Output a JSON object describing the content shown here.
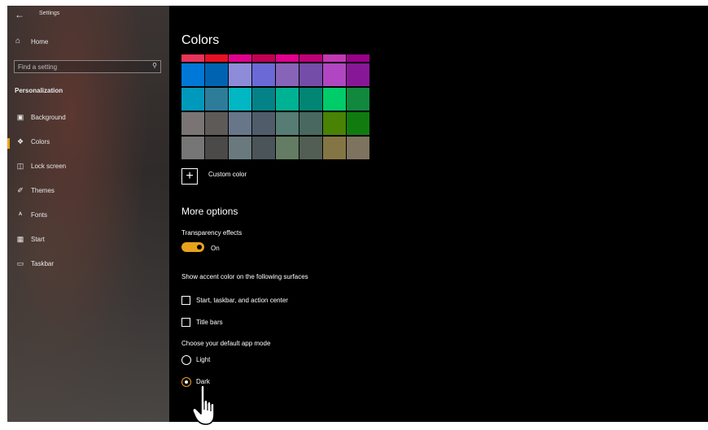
{
  "app": {
    "title": "Settings",
    "back_icon": "back-arrow-icon"
  },
  "sidebar": {
    "home": {
      "label": "Home",
      "icon": "home-icon"
    },
    "search": {
      "placeholder": "Find a setting",
      "icon": "search-icon"
    },
    "section_header": "Personalization",
    "items": [
      {
        "label": "Background",
        "icon": "picture-icon",
        "selected": false
      },
      {
        "label": "Colors",
        "icon": "palette-icon",
        "selected": true
      },
      {
        "label": "Lock screen",
        "icon": "lock-screen-icon",
        "selected": false
      },
      {
        "label": "Themes",
        "icon": "brush-icon",
        "selected": false
      },
      {
        "label": "Fonts",
        "icon": "fonts-icon",
        "selected": false
      },
      {
        "label": "Start",
        "icon": "start-icon",
        "selected": false
      },
      {
        "label": "Taskbar",
        "icon": "taskbar-icon",
        "selected": false
      }
    ]
  },
  "main": {
    "title": "Colors",
    "swatch_rows": [
      [
        "#e8345a",
        "#e81123",
        "#e3008c",
        "#c30052",
        "#e3008c",
        "#bf0077",
        "#c239b3",
        "#9a0089"
      ],
      [
        "#0078d7",
        "#0063b1",
        "#8e8cd8",
        "#6b69d6",
        "#8764b8",
        "#744da9",
        "#b146c2",
        "#881798"
      ],
      [
        "#0099bc",
        "#2d7d9a",
        "#00b7c3",
        "#038387",
        "#00b294",
        "#018574",
        "#00cc6a",
        "#10893e"
      ],
      [
        "#7a7574",
        "#5d5a58",
        "#68768a",
        "#515c6b",
        "#567c73",
        "#486860",
        "#498205",
        "#107c10"
      ],
      [
        "#767676",
        "#4c4a48",
        "#69797e",
        "#4a5459",
        "#647c64",
        "#525e54",
        "#847545",
        "#7e735f"
      ]
    ],
    "custom_color": {
      "label": "Custom color",
      "icon": "plus-icon"
    },
    "more_options": "More options",
    "transparency": {
      "label": "Transparency effects",
      "state": "On",
      "accent": "#e8a31c"
    },
    "accent_surfaces": {
      "label": "Show accent color on the following surfaces",
      "options": [
        {
          "label": "Start, taskbar, and action center",
          "checked": false
        },
        {
          "label": "Title bars",
          "checked": false
        }
      ]
    },
    "app_mode": {
      "label": "Choose your default app mode",
      "options": [
        {
          "label": "Light",
          "selected": false
        },
        {
          "label": "Dark",
          "selected": true
        }
      ]
    }
  },
  "cursor": {
    "icon": "hand-pointer-icon"
  }
}
